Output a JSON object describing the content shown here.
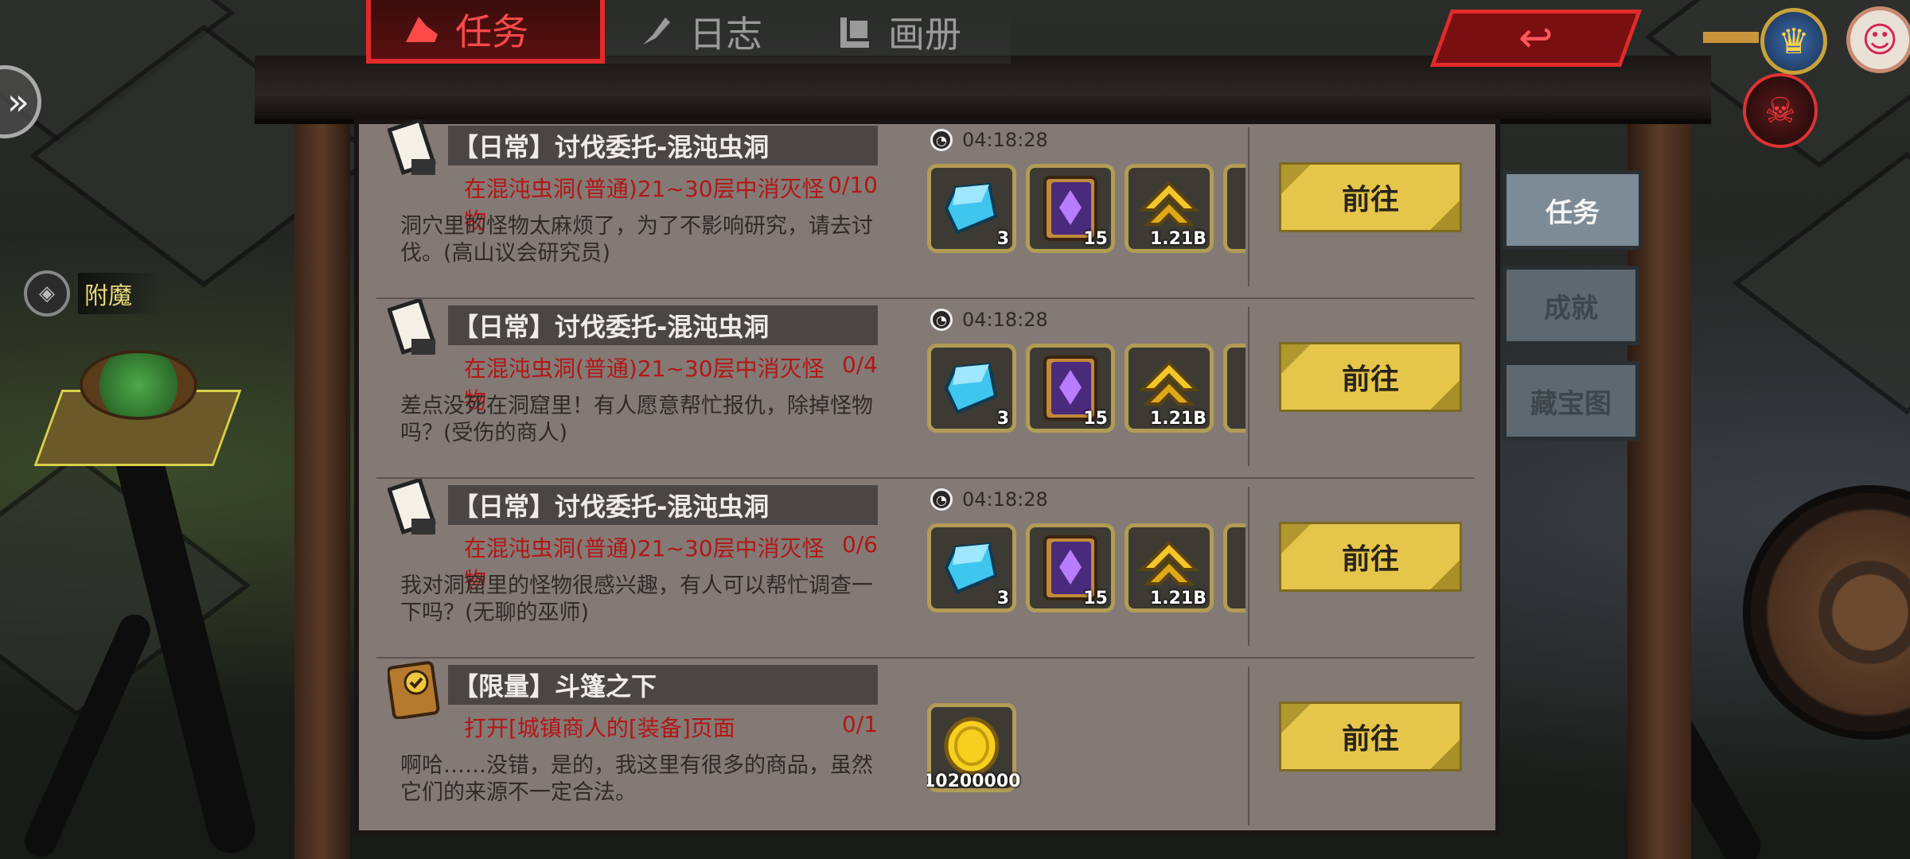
{
  "top_tabs": [
    {
      "label": "任务",
      "active": true,
      "icon": "hat-icon"
    },
    {
      "label": "日志",
      "active": false,
      "icon": "quill-icon"
    },
    {
      "label": "画册",
      "active": false,
      "icon": "album-icon"
    }
  ],
  "left_hud": {
    "enchant_label": "附魔"
  },
  "side_tabs": [
    {
      "label": "任务",
      "active": true
    },
    {
      "label": "成就",
      "active": false
    },
    {
      "label": "藏宝图",
      "active": false
    }
  ],
  "quests": [
    {
      "title": "【日常】讨伐委托-混沌虫洞",
      "objective": "在混沌虫洞(普通)21~30层中消灭怪物",
      "progress": "0/10",
      "description": "洞穴里的怪物太麻烦了，为了不影响研究，请去讨伐。(高山议会研究员)",
      "timer": "04:18:28",
      "icon": "scroll-icon",
      "rewards": [
        {
          "icon": "crystal-icon",
          "count": "3"
        },
        {
          "icon": "spellbook-icon",
          "count": "15"
        },
        {
          "icon": "upgrade-arrow-icon",
          "count": "1.21B"
        }
      ],
      "button": "前往"
    },
    {
      "title": "【日常】讨伐委托-混沌虫洞",
      "objective": "在混沌虫洞(普通)21~30层中消灭怪物",
      "progress": "0/4",
      "description": "差点没死在洞窟里！有人愿意帮忙报仇，除掉怪物吗？(受伤的商人)",
      "timer": "04:18:28",
      "icon": "scroll-icon",
      "rewards": [
        {
          "icon": "crystal-icon",
          "count": "3"
        },
        {
          "icon": "spellbook-icon",
          "count": "15"
        },
        {
          "icon": "upgrade-arrow-icon",
          "count": "1.21B"
        }
      ],
      "button": "前往"
    },
    {
      "title": "【日常】讨伐委托-混沌虫洞",
      "objective": "在混沌虫洞(普通)21~30层中消灭怪物",
      "progress": "0/6",
      "description": "我对洞窟里的怪物很感兴趣，有人可以帮忙调查一下吗？(无聊的巫师)",
      "timer": "04:18:28",
      "icon": "scroll-icon",
      "rewards": [
        {
          "icon": "crystal-icon",
          "count": "3"
        },
        {
          "icon": "spellbook-icon",
          "count": "15"
        },
        {
          "icon": "upgrade-arrow-icon",
          "count": "1.21B"
        }
      ],
      "button": "前往"
    },
    {
      "title": "【限量】斗篷之下",
      "objective": "打开[城镇商人的[装备]页面",
      "progress": "0/1",
      "description": "啊哈……没错，是的，我这里有很多的商品，虽然它们的来源不一定合法。",
      "icon": "quest-book-icon",
      "rewards": [
        {
          "icon": "gold-coin-icon",
          "count": "10200000"
        }
      ],
      "button": "前往"
    }
  ],
  "colors": {
    "panel_bg": "#837a75",
    "objective_red": "#b31616",
    "button_gold": "#e6c64a",
    "active_tab_red": "#e12b2b"
  }
}
